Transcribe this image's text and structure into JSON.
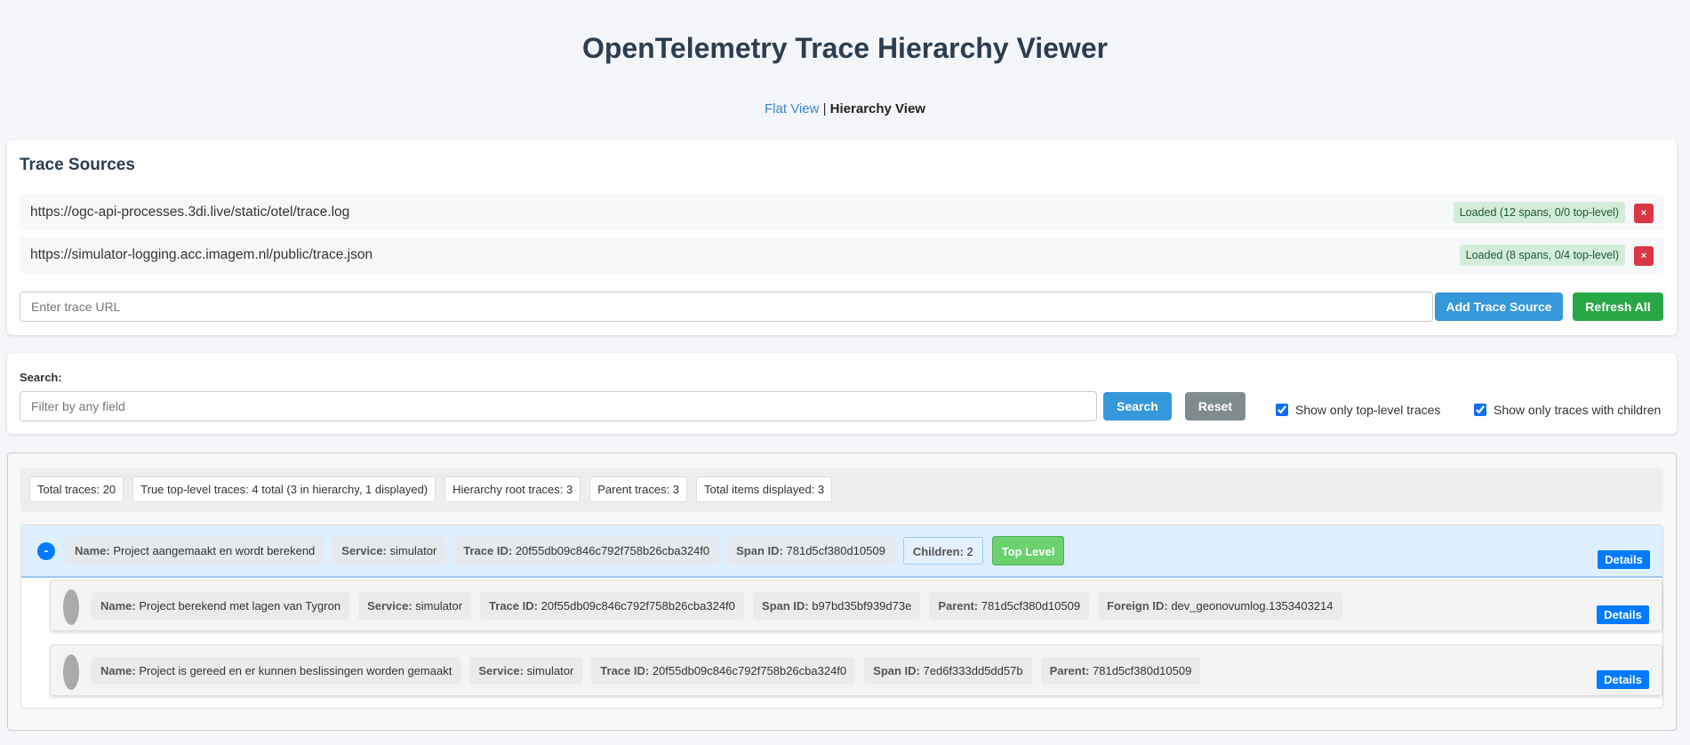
{
  "title": "OpenTelemetry Trace Hierarchy Viewer",
  "nav": {
    "flat": "Flat View",
    "sep": " | ",
    "hierarchy": "Hierarchy View"
  },
  "sources": {
    "heading": "Trace Sources",
    "items": [
      {
        "url": "https://ogc-api-processes.3di.live/static/otel/trace.log",
        "status": "Loaded (12 spans, 0/0 top-level)",
        "remove": "×"
      },
      {
        "url": "https://simulator-logging.acc.imagem.nl/public/trace.json",
        "status": "Loaded (8 spans, 0/4 top-level)",
        "remove": "×"
      }
    ],
    "url_placeholder": "Enter trace URL",
    "add_label": "Add Trace Source",
    "refresh_label": "Refresh All"
  },
  "search": {
    "label": "Search:",
    "placeholder": "Filter by any field",
    "search_label": "Search",
    "reset_label": "Reset",
    "top_level_only": {
      "label": "Show only top-level traces",
      "checked": true
    },
    "with_children_only": {
      "label": "Show only traces with children",
      "checked": true
    }
  },
  "stats": [
    "Total traces: 20",
    "True top-level traces: 4 total (3 in hierarchy, 1 displayed)",
    "Hierarchy root traces: 3",
    "Parent traces: 3",
    "Total items displayed: 3"
  ],
  "labels": {
    "name": "Name:",
    "service": "Service:",
    "trace_id": "Trace ID:",
    "span_id": "Span ID:",
    "children": "Children:",
    "parent": "Parent:",
    "foreign_id": "Foreign ID:",
    "details": "Details",
    "top_level": "Top Level",
    "collapse": "-"
  },
  "root": {
    "name": "Project aangemaakt en wordt berekend",
    "service": "simulator",
    "trace_id": "20f55db09c846c792f758b26cba324f0",
    "span_id": "781d5cf380d10509",
    "children": "2"
  },
  "children": [
    {
      "name": "Project berekend met lagen van Tygron",
      "service": "simulator",
      "trace_id": "20f55db09c846c792f758b26cba324f0",
      "span_id": "b97bd35bf939d73e",
      "parent": "781d5cf380d10509",
      "foreign_id": "dev_geonovumlog.1353403214"
    },
    {
      "name": "Project is gereed en er kunnen beslissingen worden gemaakt",
      "service": "simulator",
      "trace_id": "20f55db09c846c792f758b26cba324f0",
      "span_id": "7ed6f333dd5dd57b",
      "parent": "781d5cf380d10509"
    }
  ],
  "colors": {
    "primary": "#007bff",
    "add": "#3498db",
    "refresh": "#28a745",
    "reset": "#7f8c8d",
    "danger": "#dc3545",
    "top_level": "#6bd26f"
  }
}
